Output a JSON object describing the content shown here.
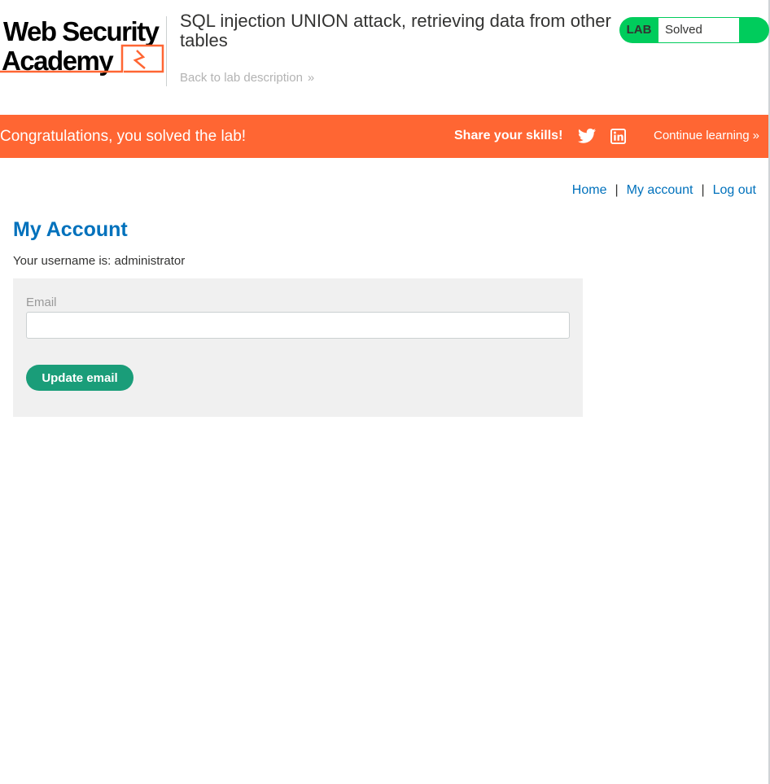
{
  "header": {
    "logo_line1": "Web Security",
    "logo_line2": "Academy",
    "lab_title": "SQL injection UNION attack, retrieving data from other tables",
    "back_link": "Back to lab description",
    "back_chevron": "»"
  },
  "status": {
    "lab_label": "LAB",
    "status_text": "Solved",
    "accent_color": "#00cc5c"
  },
  "banner": {
    "message": "Congratulations, you solved the lab!",
    "share_label": "Share your skills!",
    "continue_label": "Continue learning",
    "continue_chevron": "»",
    "background_color": "#ff6633",
    "icons": [
      "twitter-icon",
      "linkedin-icon"
    ]
  },
  "nav": {
    "home": "Home",
    "my_account": "My account",
    "log_out": "Log out",
    "separator": "|"
  },
  "account": {
    "title": "My Account",
    "username_text": "Your username is: administrator",
    "email_label": "Email",
    "email_value": "",
    "update_button": "Update email"
  }
}
